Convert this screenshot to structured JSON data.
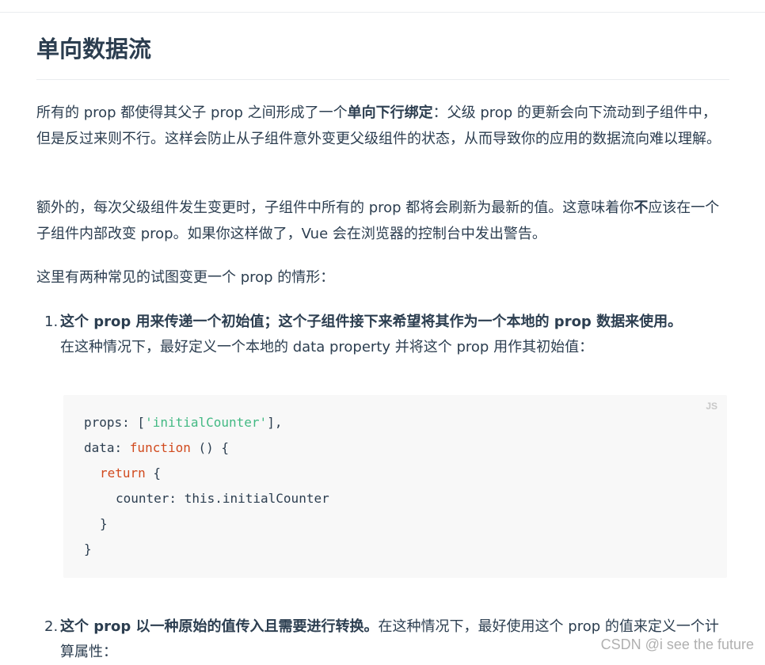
{
  "heading": "单向数据流",
  "para1": {
    "before": "所有的 prop 都使得其父子 prop 之间形成了一个",
    "bold": "单向下行绑定",
    "after": "：父级 prop 的更新会向下流动到子组件中，但是反过来则不行。这样会防止从子组件意外变更父级组件的状态，从而导致你的应用的数据流向难以理解。"
  },
  "para2": {
    "before": "额外的，每次父级组件发生变更时，子组件中所有的 prop 都将会刷新为最新的值。这意味着你",
    "bold": "不",
    "after": "应该在一个子组件内部改变 prop。如果你这样做了，Vue 会在浏览器的控制台中发出警告。"
  },
  "para3": "这里有两种常见的试图变更一个 prop 的情形：",
  "list": [
    {
      "num": "1.",
      "bold": "这个 prop 用来传递一个初始值；这个子组件接下来希望将其作为一个本地的 prop 数据来使用。",
      "text": "在这种情况下，最好定义一个本地的 data property 并将这个 prop 用作其初始值："
    },
    {
      "num": "2.",
      "bold": "这个 prop 以一种原始的值传入且需要进行转换。",
      "text": "在这种情况下，最好使用这个 prop 的值来定义一个计算属性："
    }
  ],
  "code": {
    "lang": "JS",
    "l1a": "props: [",
    "l1s": "'initialCounter'",
    "l1b": "],",
    "l2a": "data: ",
    "l2k": "function",
    "l2b": " () {",
    "l3k": "return",
    "l3b": " {",
    "l4": "counter: this.initialCounter",
    "l5": "}",
    "l6": "}"
  },
  "watermark": "CSDN @i see the future"
}
